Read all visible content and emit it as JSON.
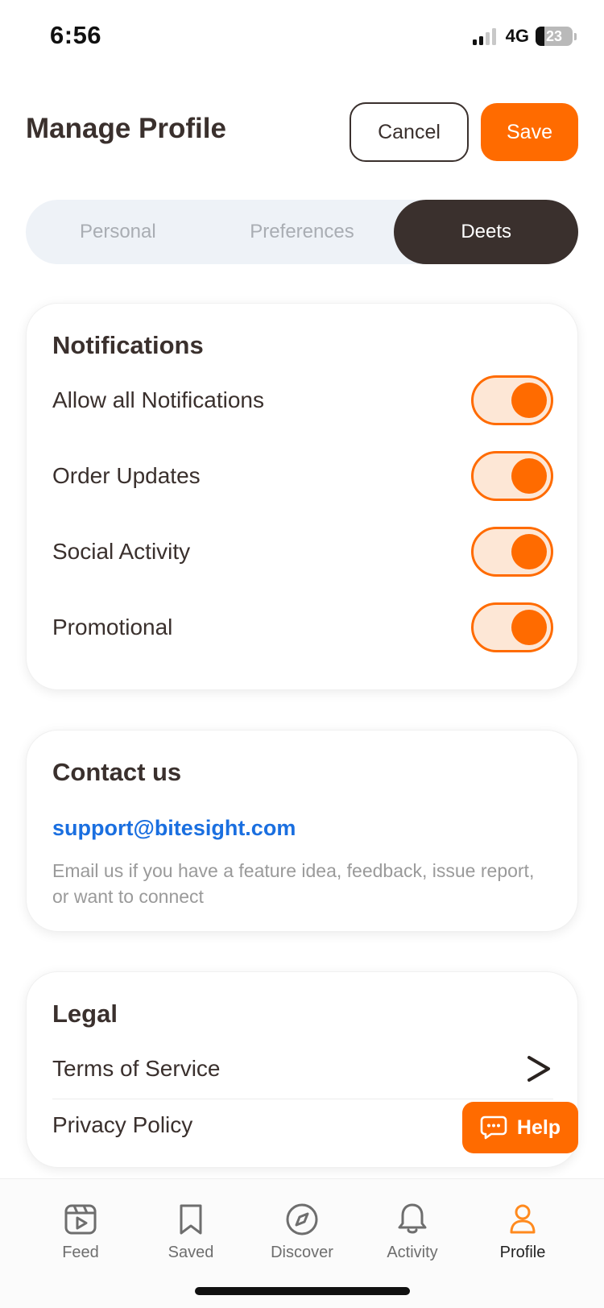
{
  "status_bar": {
    "time": "6:56",
    "network": "4G",
    "battery": "23"
  },
  "header": {
    "title": "Manage Profile",
    "cancel_label": "Cancel",
    "save_label": "Save"
  },
  "tabs": [
    {
      "label": "Personal",
      "active": false
    },
    {
      "label": "Preferences",
      "active": false
    },
    {
      "label": "Deets",
      "active": true
    }
  ],
  "notifications": {
    "title": "Notifications",
    "items": [
      {
        "label": "Allow all Notifications",
        "on": true
      },
      {
        "label": "Order Updates",
        "on": true
      },
      {
        "label": "Social Activity",
        "on": true
      },
      {
        "label": "Promotional",
        "on": true
      }
    ]
  },
  "contact": {
    "title": "Contact us",
    "email": "support@bitesight.com",
    "description": "Email us if you have a feature idea, feedback, issue report, or want to connect"
  },
  "legal": {
    "title": "Legal",
    "items": [
      {
        "label": "Terms of Service"
      },
      {
        "label": "Privacy Policy"
      }
    ]
  },
  "help": {
    "label": "Help"
  },
  "bottom_nav": {
    "items": [
      {
        "label": "Feed",
        "icon": "feed-icon"
      },
      {
        "label": "Saved",
        "icon": "bookmark-icon"
      },
      {
        "label": "Discover",
        "icon": "compass-icon"
      },
      {
        "label": "Activity",
        "icon": "bell-icon"
      },
      {
        "label": "Profile",
        "icon": "profile-icon",
        "active": true
      }
    ]
  },
  "colors": {
    "accent": "#ff6b00",
    "text_dark": "#3a302d",
    "link": "#1a6fe0",
    "tab_bg": "#eef2f7",
    "toggle_bg": "#fde7d6"
  }
}
